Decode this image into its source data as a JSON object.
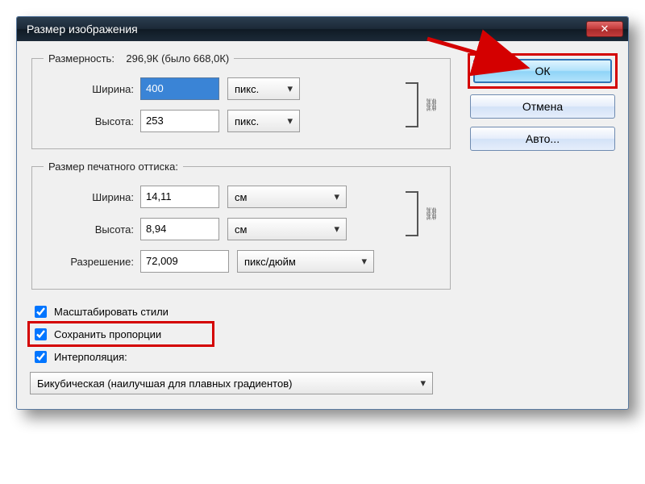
{
  "window": {
    "title": "Размер изображения"
  },
  "dimensions": {
    "legend": "Размерность:",
    "summary": "296,9К (было 668,0К)",
    "width_label": "Ширина:",
    "width_value": "400",
    "height_label": "Высота:",
    "height_value": "253",
    "unit": "пикс."
  },
  "print": {
    "legend": "Размер печатного оттиска:",
    "width_label": "Ширина:",
    "width_value": "14,11",
    "height_label": "Высота:",
    "height_value": "8,94",
    "unit": "см",
    "res_label": "Разрешение:",
    "res_value": "72,009",
    "res_unit": "пикс/дюйм"
  },
  "checks": {
    "scale_styles": "Масштабировать стили",
    "constrain": "Сохранить пропорции",
    "resample": "Интерполяция:"
  },
  "interpolation": "Бикубическая (наилучшая для плавных градиентов)",
  "buttons": {
    "ok": "ОК",
    "cancel": "Отмена",
    "auto": "Авто..."
  }
}
